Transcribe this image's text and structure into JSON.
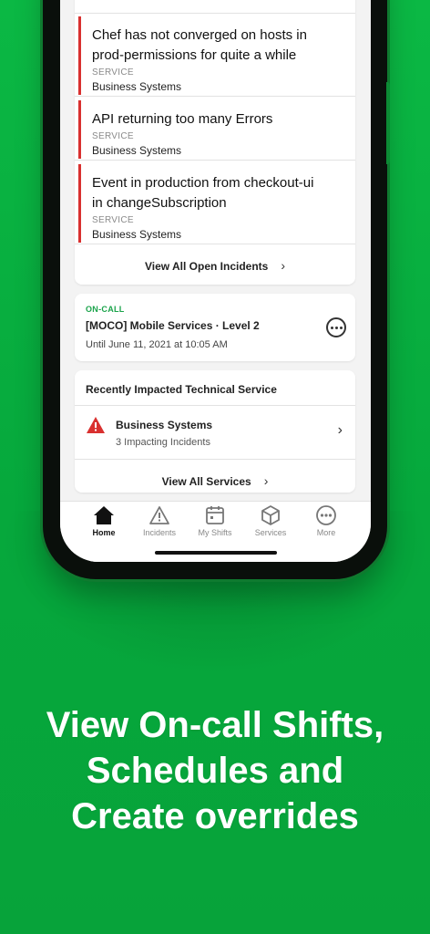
{
  "incidents": [
    {
      "title_line1": "Chef has not converged on hosts in",
      "title_line2": "prod-permissions for quite a while",
      "tag": "SERVICE",
      "team": "Business Systems"
    },
    {
      "title_line1": "API returning too many Errors",
      "title_line2": "",
      "tag": "SERVICE",
      "team": "Business Systems"
    },
    {
      "title_line1": "Event in production from checkout-ui",
      "title_line2": "in changeSubscription",
      "tag": "SERVICE",
      "team": "Business Systems"
    }
  ],
  "view_all_incidents": "View All Open Incidents",
  "oncall": {
    "label": "ON-CALL",
    "name": "[MOCO] Mobile Services · Level 2",
    "until": "Until June 11, 2021 at 10:05 AM"
  },
  "services": {
    "title": "Recently Impacted Technical Service",
    "item_name": "Business Systems",
    "item_count": "3 Impacting Incidents",
    "view_all": "View All Services"
  },
  "tabs": [
    {
      "label": "Home",
      "icon": "home-icon",
      "active": true
    },
    {
      "label": "Incidents",
      "icon": "warning-icon",
      "active": false
    },
    {
      "label": "My Shifts",
      "icon": "calendar-icon",
      "active": false
    },
    {
      "label": "Services",
      "icon": "cube-icon",
      "active": false
    },
    {
      "label": "More",
      "icon": "more-icon",
      "active": false
    }
  ],
  "headline": {
    "line1": "View On-call Shifts,",
    "line2": "Schedules and",
    "line3": "Create overrides"
  },
  "colors": {
    "brand_green": "#06ac38",
    "incident_red": "#d9302f",
    "oncall_green": "#1aa34a"
  }
}
